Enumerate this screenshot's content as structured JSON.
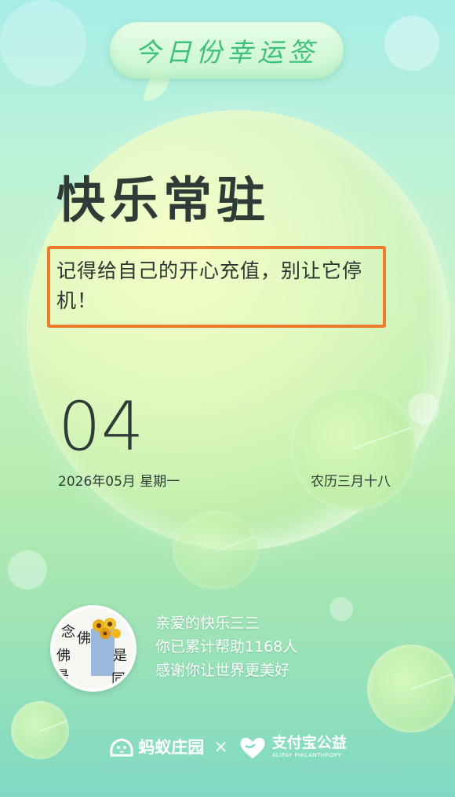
{
  "header": {
    "title": "今日份幸运签"
  },
  "fortune": {
    "title": "快乐常驻",
    "quote": "记得给自己的开心充值，别让它停机！"
  },
  "calendar": {
    "day": "04",
    "date": "2026年05月 星期一",
    "lunar": "农历三月十八"
  },
  "user": {
    "greeting": "亲爱的快乐三三",
    "helped": "你已累计帮助1168人",
    "thanks": "感谢你让世界更美好",
    "avatar_chars": [
      "念",
      "佛",
      "是",
      "佛",
      "是",
      "同"
    ]
  },
  "footer": {
    "brand_left": "蚂蚁庄园",
    "separator": "×",
    "brand_right": "支付宝公益",
    "brand_right_en": "ALIPAY PHILANTHROPY"
  },
  "colors": {
    "accent_green": "#3fc07a",
    "highlight_box": "#f07a2b",
    "text_dark": "#2f3b36"
  }
}
